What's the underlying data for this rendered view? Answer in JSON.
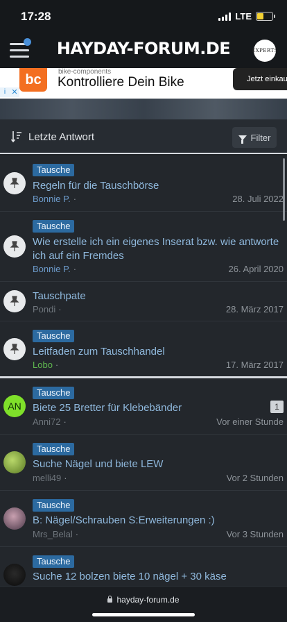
{
  "status_bar": {
    "time": "17:28",
    "network": "LTE",
    "battery_level": 0.45
  },
  "header": {
    "logo": "HAYDAY-FORUM.DE",
    "avatar_text": "EXPERTS"
  },
  "ad": {
    "brand": "bike-components",
    "logo_text": "bc",
    "title": "Kontrolliere Dein Bike",
    "cta": "Jetzt einkau",
    "info": "i",
    "close": "✕"
  },
  "filter_bar": {
    "sort_label": "Letzte Antwort",
    "filter_label": "Filter"
  },
  "threads": [
    {
      "tag": "Tausche",
      "title": "Regeln für die Tauschbörse",
      "author": "Bonnie P.",
      "date": "28. Juli 2022",
      "pinned": true
    },
    {
      "tag": "Tausche",
      "title": "Wie erstelle ich ein eigenes Inserat bzw. wie antworte ich auf ein Fremdes",
      "author": "Bonnie P.",
      "date": "26. April 2020",
      "pinned": true
    },
    {
      "tag": "",
      "title": "Tauschpate",
      "author": "Pondi",
      "date": "28. März 2017",
      "pinned": true
    },
    {
      "tag": "Tausche",
      "title": "Leitfaden zum Tauschhandel",
      "author": "Lobo",
      "date": "17. März 2017",
      "pinned": true
    },
    {
      "tag": "Tausche",
      "title": "Biete 25 Bretter für Klebebänder",
      "author": "Anni72",
      "date": "Vor einer Stunde",
      "replies": "1",
      "avatar_initials": "AN"
    },
    {
      "tag": "Tausche",
      "title": "Suche Nägel und biete LEW",
      "author": "melli49",
      "date": "Vor 2 Stunden"
    },
    {
      "tag": "Tausche",
      "title": "B: Nägel/Schrauben S:Erweiterungen :)",
      "author": "Mrs_Belal",
      "date": "Vor 3 Stunden"
    },
    {
      "tag": "Tausche",
      "title": "Suche 12 bolzen biete 10 nägel + 30 käse",
      "author": "",
      "date": ""
    }
  ],
  "separator": "·",
  "bottom_bar": {
    "url": "hayday-forum.de"
  },
  "colors": {
    "accent": "#2c6aa0",
    "link": "#8fb8dc",
    "background": "#1e2226"
  }
}
